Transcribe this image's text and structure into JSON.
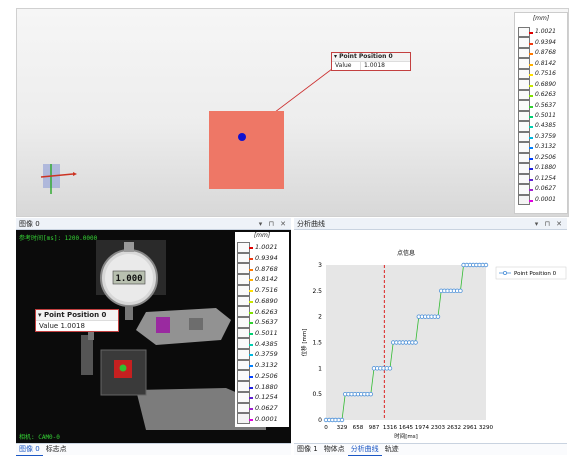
{
  "viewport": {
    "popup": {
      "title": "Point Position 0",
      "key": "Value",
      "value": "1.0018"
    },
    "colorbar": {
      "unit": "[mm]",
      "labels": [
        "1.0021",
        "0.9394",
        "0.8768",
        "0.8142",
        "0.7516",
        "0.6890",
        "0.6263",
        "0.5637",
        "0.5011",
        "0.4385",
        "0.3759",
        "0.3132",
        "0.2506",
        "0.1880",
        "0.1254",
        "0.0627",
        "0.0001"
      ],
      "colors": [
        "#e00000",
        "#f03a10",
        "#ff7a00",
        "#ffb000",
        "#ffe000",
        "#c8e600",
        "#80e000",
        "#30d030",
        "#00d070",
        "#00d0b0",
        "#00b8e0",
        "#0080ff",
        "#0040ff",
        "#2020e0",
        "#6020d0",
        "#a020d0",
        "#e000e0"
      ]
    },
    "square_color": "#ee7766",
    "dot_color": "#1010d0"
  },
  "image_panel": {
    "title": "图像 0",
    "tools": "▾ ⊓ ✕",
    "ref_time": "参考时间[ms]: 1200.0000",
    "camera": "相机: CAM0-0",
    "gauge_reading": "1.000",
    "popup": {
      "title": "Point Position 0",
      "value": "Value 1.0018"
    },
    "colorbar": {
      "unit": "[mm]",
      "labels": [
        "1.0021",
        "0.9394",
        "0.8768",
        "0.8142",
        "0.7516",
        "0.6890",
        "0.6263",
        "0.5637",
        "0.5011",
        "0.4385",
        "0.3759",
        "0.3132",
        "0.2506",
        "0.1880",
        "0.1254",
        "0.0627",
        "0.0001"
      ]
    },
    "tabs": [
      "图像 0",
      "标志点"
    ]
  },
  "curve_panel": {
    "title": "分析曲线",
    "tools": "▾ ⊓ ✕",
    "tabs": [
      "图像 1",
      "物体点",
      "分析曲线",
      "轨迹"
    ],
    "active_tab": 2
  },
  "chart_data": {
    "type": "line",
    "title": "点信息",
    "xlabel": "时间[ms]",
    "ylabel": "位移 [mm]",
    "x_ticks": [
      "0",
      "329",
      "658",
      "987",
      "1316",
      "1645",
      "1974",
      "2303",
      "2632",
      "2961",
      "3290"
    ],
    "y_ticks": [
      "0",
      "0.5",
      "1",
      "1.5",
      "2",
      "2.5",
      "3"
    ],
    "xlim": [
      0,
      3290
    ],
    "ylim": [
      0,
      3
    ],
    "marker_line_x": 1200,
    "legend_position": "top-right",
    "series": [
      {
        "name": "Point Position 0",
        "color": "#4a8fd8",
        "line_color": "#33bb33",
        "x": [
          0,
          66,
          132,
          197,
          263,
          329,
          395,
          461,
          526,
          592,
          658,
          724,
          790,
          855,
          921,
          987,
          1053,
          1119,
          1184,
          1250,
          1316,
          1382,
          1448,
          1513,
          1579,
          1645,
          1711,
          1777,
          1842,
          1908,
          1974,
          2040,
          2106,
          2171,
          2237,
          2303,
          2369,
          2435,
          2500,
          2566,
          2632,
          2698,
          2764,
          2829,
          2895,
          2961,
          3027,
          3093,
          3158,
          3224,
          3290
        ],
        "y": [
          0,
          0,
          0,
          0,
          0,
          0,
          0.5,
          0.5,
          0.5,
          0.5,
          0.5,
          0.5,
          0.5,
          0.5,
          0.5,
          1,
          1,
          1,
          1,
          1,
          1,
          1.5,
          1.5,
          1.5,
          1.5,
          1.5,
          1.5,
          1.5,
          1.5,
          2,
          2,
          2,
          2,
          2,
          2,
          2,
          2.5,
          2.5,
          2.5,
          2.5,
          2.5,
          2.5,
          2.5,
          3,
          3,
          3,
          3,
          3,
          3,
          3,
          3
        ]
      }
    ]
  }
}
